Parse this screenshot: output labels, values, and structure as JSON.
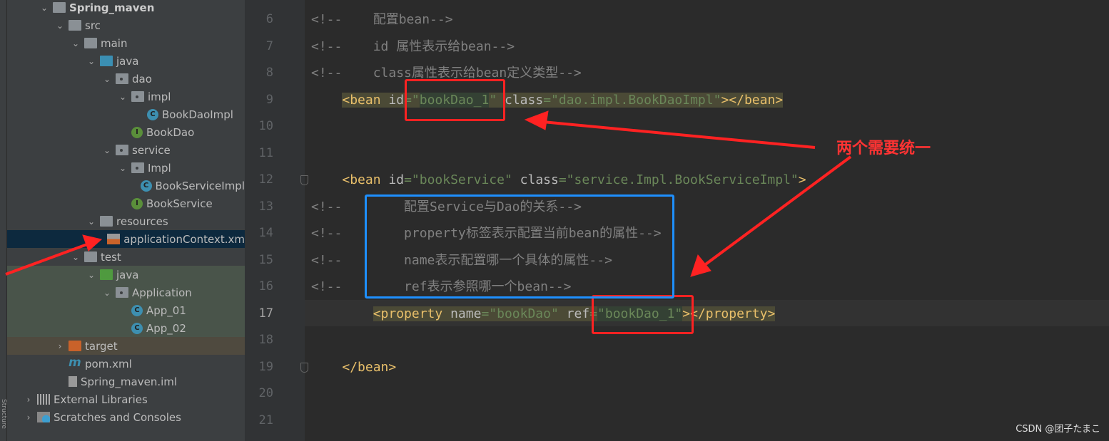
{
  "project_tree": [
    {
      "label": "Spring_maven",
      "depth": 1,
      "icon": "module-folder-icon",
      "expanded": true,
      "bold": true
    },
    {
      "label": "src",
      "depth": 2,
      "icon": "folder-icon",
      "expanded": true
    },
    {
      "label": "main",
      "depth": 3,
      "icon": "folder-icon",
      "expanded": true
    },
    {
      "label": "java",
      "depth": 4,
      "icon": "source-folder-icon",
      "expanded": true
    },
    {
      "label": "dao",
      "depth": 5,
      "icon": "package-icon",
      "expanded": true
    },
    {
      "label": "impl",
      "depth": 6,
      "icon": "package-icon",
      "expanded": true
    },
    {
      "label": "BookDaoImpl",
      "depth": 7,
      "icon": "class-icon"
    },
    {
      "label": "BookDao",
      "depth": 6,
      "icon": "interface-icon"
    },
    {
      "label": "service",
      "depth": 5,
      "icon": "package-icon",
      "expanded": true
    },
    {
      "label": "Impl",
      "depth": 6,
      "icon": "package-icon",
      "expanded": true
    },
    {
      "label": "BookServiceImpl",
      "depth": 7,
      "icon": "class-icon"
    },
    {
      "label": "BookService",
      "depth": 6,
      "icon": "interface-icon"
    },
    {
      "label": "resources",
      "depth": 4,
      "icon": "resources-folder-icon",
      "expanded": true
    },
    {
      "label": "applicationContext.xm",
      "depth": 5,
      "icon": "spring-xml-icon",
      "selected": true
    },
    {
      "label": "test",
      "depth": 3,
      "icon": "folder-icon",
      "expanded": true
    },
    {
      "label": "java",
      "depth": 4,
      "icon": "test-folder-icon",
      "expanded": true,
      "test": true
    },
    {
      "label": "Application",
      "depth": 5,
      "icon": "package-icon",
      "expanded": true,
      "test": true
    },
    {
      "label": "App_01",
      "depth": 6,
      "icon": "runnable-class-icon",
      "test": true
    },
    {
      "label": "App_02",
      "depth": 6,
      "icon": "runnable-class-icon",
      "test": true
    },
    {
      "label": "target",
      "depth": 2,
      "icon": "excluded-folder-icon",
      "expanded": false,
      "excluded": true
    },
    {
      "label": "pom.xml",
      "depth": 2,
      "icon": "maven-icon"
    },
    {
      "label": "Spring_maven.iml",
      "depth": 2,
      "icon": "iml-file-icon"
    },
    {
      "label": "External Libraries",
      "depth": 0,
      "icon": "libraries-icon",
      "expanded": false
    },
    {
      "label": "Scratches and Consoles",
      "depth": 0,
      "icon": "scratches-icon",
      "expanded": false
    }
  ],
  "side_tab_label": "Structure",
  "editor": {
    "current_line": 17,
    "lines": [
      {
        "n": 6,
        "tokens": [
          [
            "com",
            "<!--    配置bean-->"
          ]
        ]
      },
      {
        "n": 7,
        "tokens": [
          [
            "com",
            "<!--    id 属性表示给bean-->"
          ]
        ]
      },
      {
        "n": 8,
        "tokens": [
          [
            "com",
            "<!--    class属性表示给bean定义类型-->"
          ]
        ]
      },
      {
        "n": 9,
        "hl": true,
        "tokens": [
          [
            "sp",
            "    "
          ],
          [
            "tag",
            "<bean "
          ],
          [
            "attr",
            "id"
          ],
          [
            "val",
            "=\""
          ],
          [
            "idval",
            "bookDao_1"
          ],
          [
            "val",
            "\" "
          ],
          [
            "attr",
            "class"
          ],
          [
            "val",
            "=\"dao.impl.BookDaoImpl\""
          ],
          [
            "tag",
            "></bean>"
          ]
        ]
      },
      {
        "n": 10,
        "tokens": []
      },
      {
        "n": 11,
        "tokens": []
      },
      {
        "n": 12,
        "fold": true,
        "tokens": [
          [
            "sp",
            "    "
          ],
          [
            "tag",
            "<bean "
          ],
          [
            "attr",
            "id"
          ],
          [
            "val",
            "=\"bookService\" "
          ],
          [
            "attr",
            "class"
          ],
          [
            "val",
            "=\"service.Impl.BookServiceImpl\""
          ],
          [
            "tag",
            ">"
          ]
        ]
      },
      {
        "n": 13,
        "tokens": [
          [
            "com",
            "<!--        配置Service与Dao的关系-->"
          ]
        ]
      },
      {
        "n": 14,
        "tokens": [
          [
            "com",
            "<!--        property标签表示配置当前bean的属性-->"
          ]
        ]
      },
      {
        "n": 15,
        "tokens": [
          [
            "com",
            "<!--        name表示配置哪一个具体的属性-->"
          ]
        ]
      },
      {
        "n": 16,
        "tokens": [
          [
            "com",
            "<!--        ref表示参照哪一个bean-->"
          ]
        ]
      },
      {
        "n": 17,
        "hl": true,
        "tokens": [
          [
            "sp",
            "        "
          ],
          [
            "tag",
            "<property "
          ],
          [
            "attr",
            "name"
          ],
          [
            "val",
            "=\"bookDao\" "
          ],
          [
            "attr",
            "ref"
          ],
          [
            "val",
            "="
          ],
          [
            "idval",
            "\"bookDao_1\""
          ],
          [
            "tag",
            "></property>"
          ]
        ]
      },
      {
        "n": 18,
        "tokens": []
      },
      {
        "n": 19,
        "fold": true,
        "tokens": [
          [
            "sp",
            "    "
          ],
          [
            "tag",
            "</bean>"
          ]
        ]
      },
      {
        "n": 20,
        "tokens": []
      },
      {
        "n": 21,
        "tokens": []
      }
    ]
  },
  "annotation": {
    "text": "两个需要统一",
    "color": "#ff2222",
    "box_color": "#1e90ff"
  },
  "watermark": "CSDN @团子たまこ"
}
